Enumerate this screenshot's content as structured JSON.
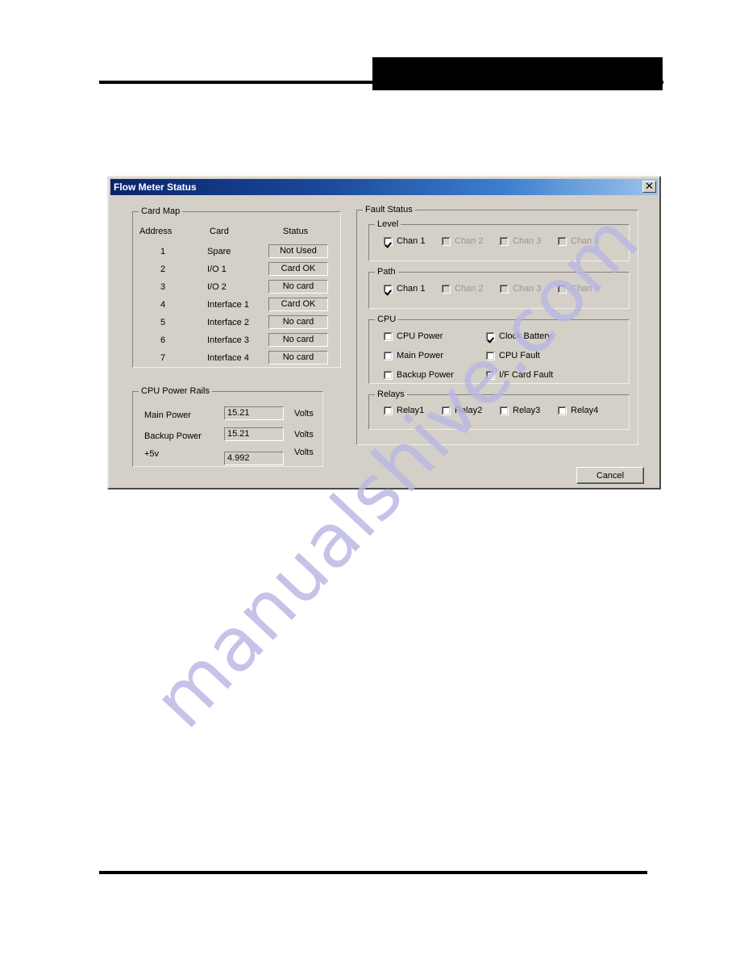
{
  "page": {
    "header_block_redacted": true
  },
  "watermark": {
    "text": "manualshive.com",
    "color": "#b9b7e4"
  },
  "dialog": {
    "title": "Flow Meter Status",
    "close_icon": "close-x-icon",
    "titlebar_color_start": "#0a246a",
    "titlebar_color_end": "#9cc4ea",
    "face_color": "#d4d0c8",
    "card_map": {
      "title": "Card Map",
      "columns": [
        "Address",
        "Card",
        "Status"
      ],
      "rows": [
        {
          "address": "1",
          "card": "Spare",
          "status": "Not Used"
        },
        {
          "address": "2",
          "card": "I/O 1",
          "status": "Card OK"
        },
        {
          "address": "3",
          "card": "I/O 2",
          "status": "No card"
        },
        {
          "address": "4",
          "card": "Interface 1",
          "status": "Card OK"
        },
        {
          "address": "5",
          "card": "Interface 2",
          "status": "No card"
        },
        {
          "address": "6",
          "card": "Interface 3",
          "status": "No card"
        },
        {
          "address": "7",
          "card": "Interface 4",
          "status": "No card"
        }
      ]
    },
    "cpu_power_rails": {
      "title": "CPU Power Rails",
      "rows": [
        {
          "label": "Main Power",
          "value": "15.21",
          "unit": "Volts"
        },
        {
          "label": "Backup Power",
          "value": "15.21",
          "unit": "Volts"
        },
        {
          "label": "+5v",
          "value": "4.992",
          "unit": "Volts"
        }
      ]
    },
    "fault_status": {
      "title": "Fault Status",
      "level": {
        "title": "Level",
        "items": [
          {
            "label": "Chan 1",
            "checked": true,
            "disabled": false
          },
          {
            "label": "Chan 2",
            "checked": false,
            "disabled": true
          },
          {
            "label": "Chan 3",
            "checked": false,
            "disabled": true
          },
          {
            "label": "Chan 4",
            "checked": false,
            "disabled": true
          }
        ]
      },
      "path": {
        "title": "Path",
        "items": [
          {
            "label": "Chan 1",
            "checked": true,
            "disabled": false
          },
          {
            "label": "Chan 2",
            "checked": false,
            "disabled": true
          },
          {
            "label": "Chan 3",
            "checked": false,
            "disabled": true
          },
          {
            "label": "Chan 4",
            "checked": false,
            "disabled": true
          }
        ]
      },
      "cpu": {
        "title": "CPU",
        "items": [
          {
            "label": "CPU Power",
            "checked": false,
            "disabled": false
          },
          {
            "label": "Main Power",
            "checked": false,
            "disabled": false
          },
          {
            "label": "Backup Power",
            "checked": false,
            "disabled": false
          },
          {
            "label": "Clock Battery",
            "checked": true,
            "disabled": false
          },
          {
            "label": "CPU Fault",
            "checked": false,
            "disabled": false
          },
          {
            "label": "I/F Card Fault",
            "checked": false,
            "disabled": false
          }
        ]
      },
      "relays": {
        "title": "Relays",
        "items": [
          {
            "label": "Relay1",
            "checked": false,
            "disabled": false
          },
          {
            "label": "Relay2",
            "checked": false,
            "disabled": false
          },
          {
            "label": "Relay3",
            "checked": false,
            "disabled": false
          },
          {
            "label": "Relay4",
            "checked": false,
            "disabled": false
          }
        ]
      }
    },
    "cancel_label": "Cancel"
  }
}
